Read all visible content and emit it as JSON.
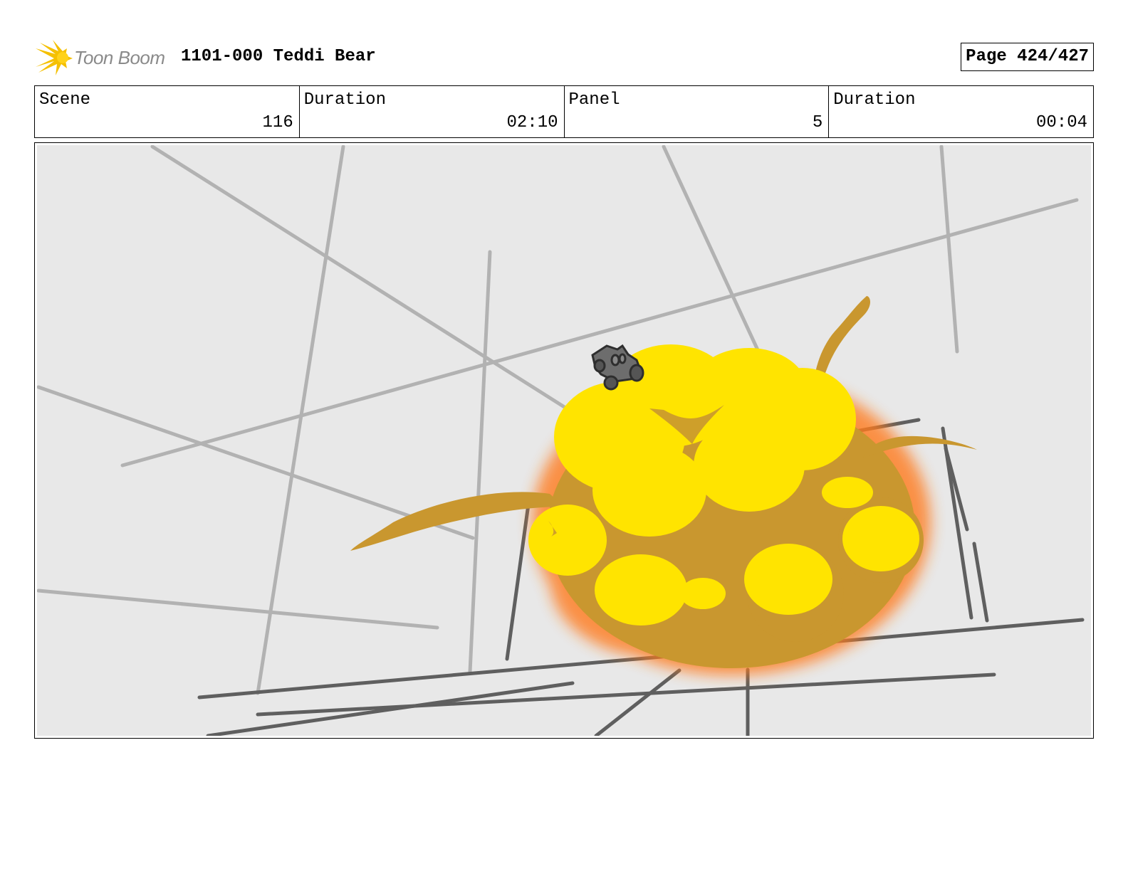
{
  "header": {
    "brand": "Toon Boom",
    "project_title": "1101-000 Teddi Bear",
    "page_label": "Page 424/427"
  },
  "info": {
    "scene_label": "Scene",
    "scene_value": "116",
    "scene_duration_label": "Duration",
    "scene_duration_value": "02:10",
    "panel_label": "Panel",
    "panel_value": "5",
    "panel_duration_label": "Duration",
    "panel_duration_value": "00:04"
  },
  "colors": {
    "brand_yellow": "#f5c000",
    "panel_bg": "#e8e8e8",
    "explosion_yellow": "#ffe400",
    "explosion_orange": "#c9972f",
    "explosion_glow": "#ff7a1a"
  },
  "icons": {
    "logo": "toon-boom-starburst-icon"
  }
}
